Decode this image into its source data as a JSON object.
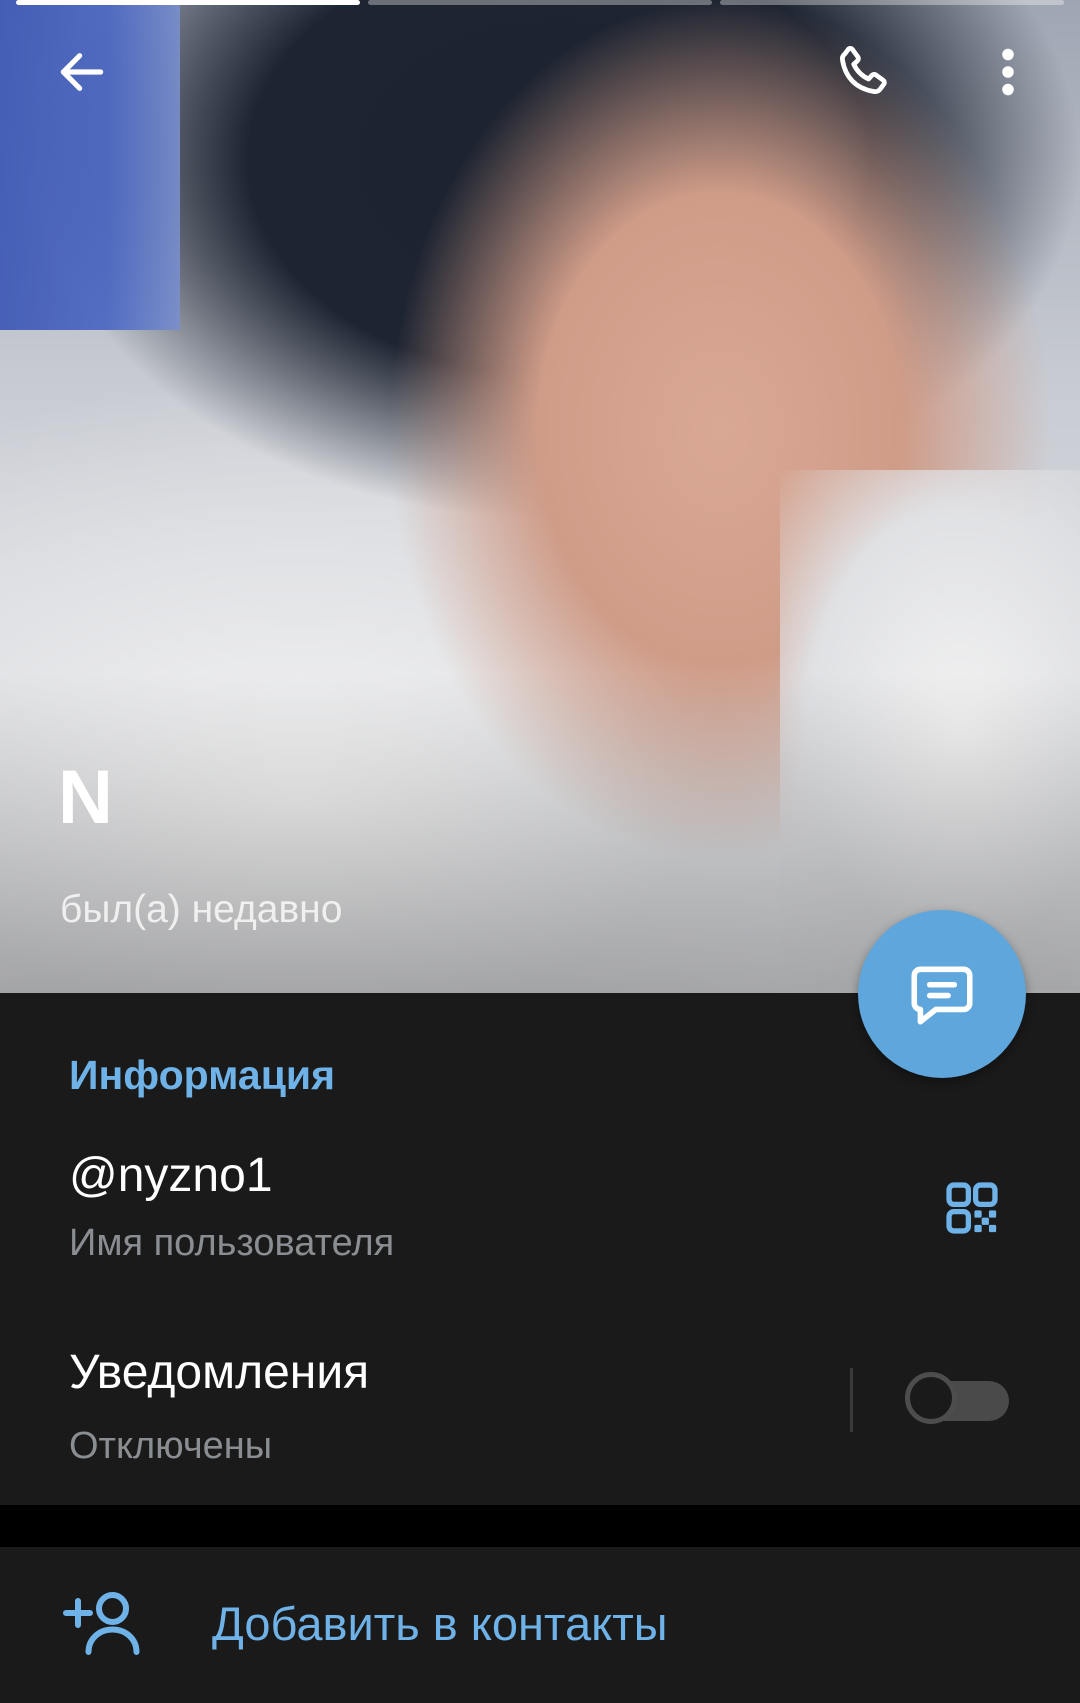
{
  "profile": {
    "name": "N",
    "status": "был(а) недавно"
  },
  "story_progress": {
    "segments": 3,
    "active_index": 0
  },
  "header_icons": {
    "back": "arrow-left-icon",
    "call": "phone-icon",
    "more": "more-vertical-icon"
  },
  "fab": {
    "icon": "message-icon",
    "color": "#5ea6dc"
  },
  "info": {
    "section_title": "Информация",
    "username": "@nyzno1",
    "username_label": "Имя пользователя",
    "qr_icon": "qr-code-icon",
    "notifications_title": "Уведомления",
    "notifications_status": "Отключены",
    "notifications_enabled": false
  },
  "actions": {
    "add_contact_label": "Добавить в контакты",
    "add_contact_icon": "add-user-icon"
  },
  "colors": {
    "accent": "#6fb2e8",
    "background": "#1a1a1a",
    "secondary_text": "#8a8d91"
  }
}
